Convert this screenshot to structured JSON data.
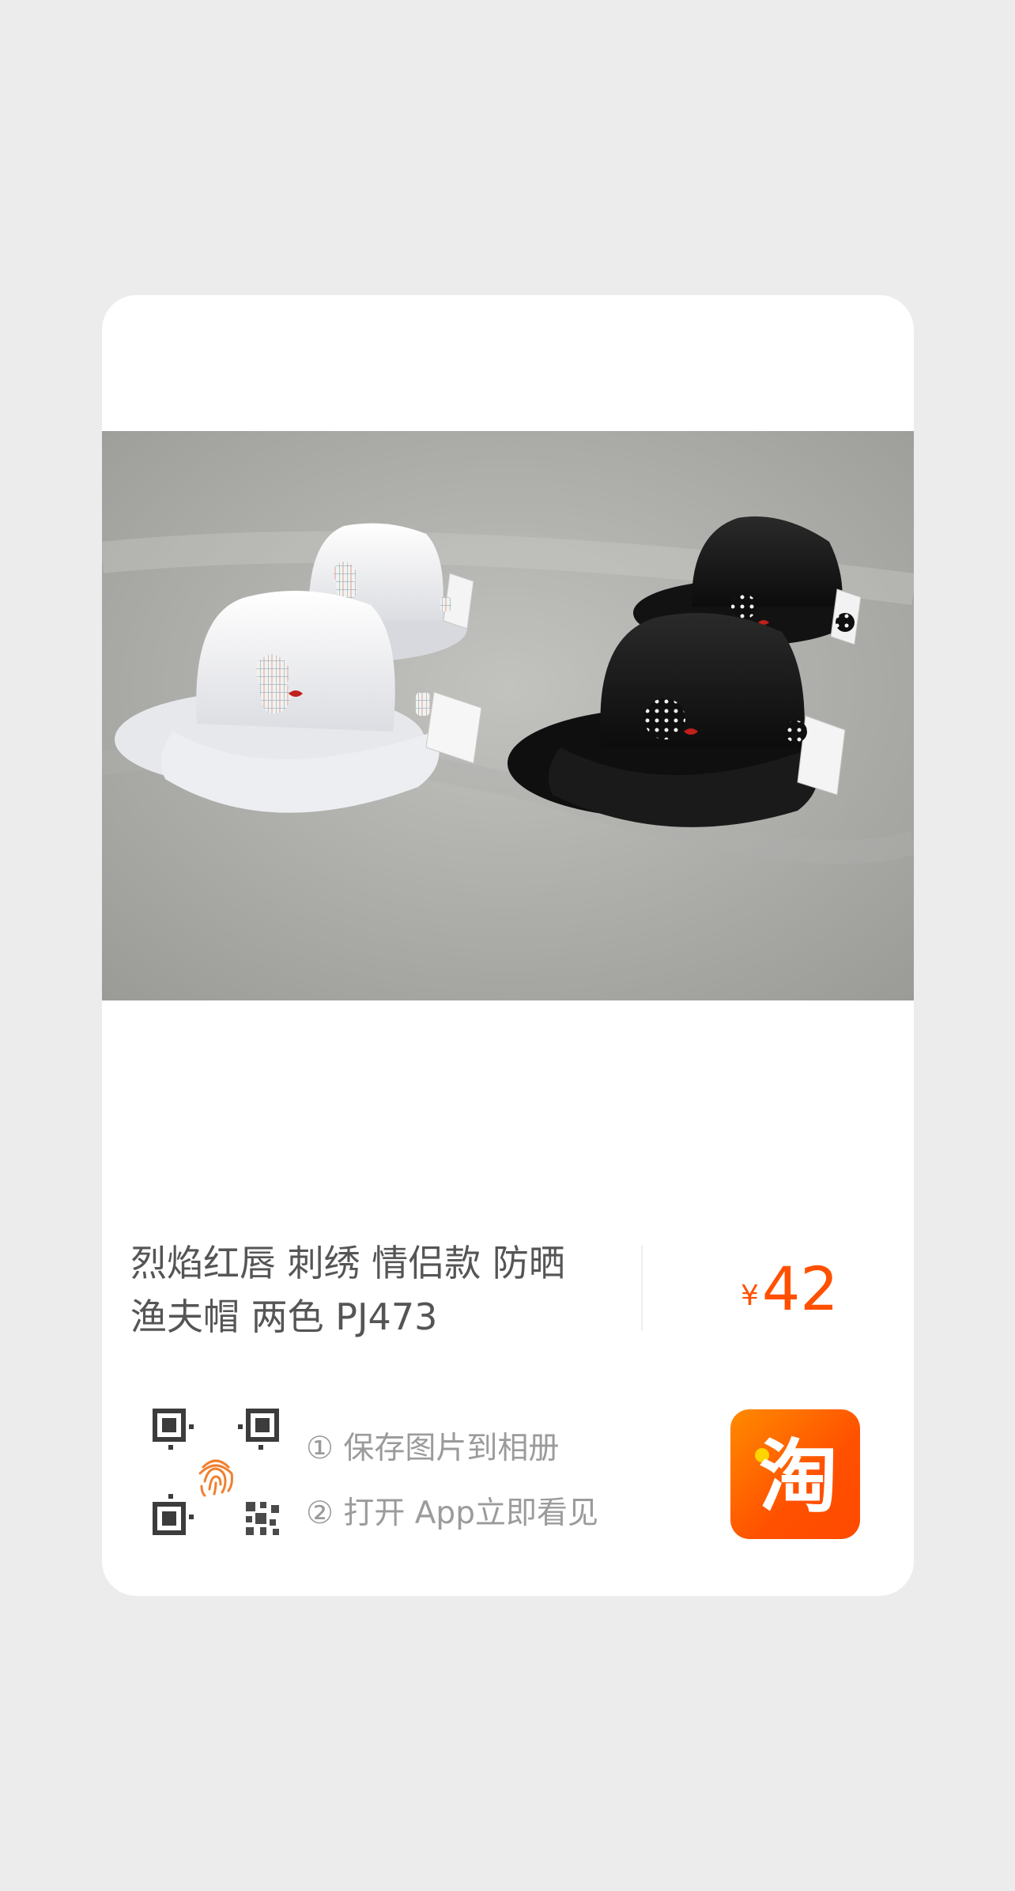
{
  "product": {
    "title_line1": "烈焰红唇 刺绣 情侣款 防晒",
    "title_line2": "渔夫帽 两色 PJ473",
    "currency_symbol": "¥",
    "price": "42"
  },
  "share": {
    "step1": "① 保存图片到相册",
    "step2": "② 打开 App立即看见",
    "qr_icon": "qr-code-icon",
    "fingerprint_icon": "fingerprint-icon",
    "app_logo_icon": "taobao-logo-icon",
    "app_logo_text": "淘"
  },
  "colors": {
    "price": "#ff5000",
    "logo": "#ff5000",
    "fingerprint": "#f08030"
  }
}
